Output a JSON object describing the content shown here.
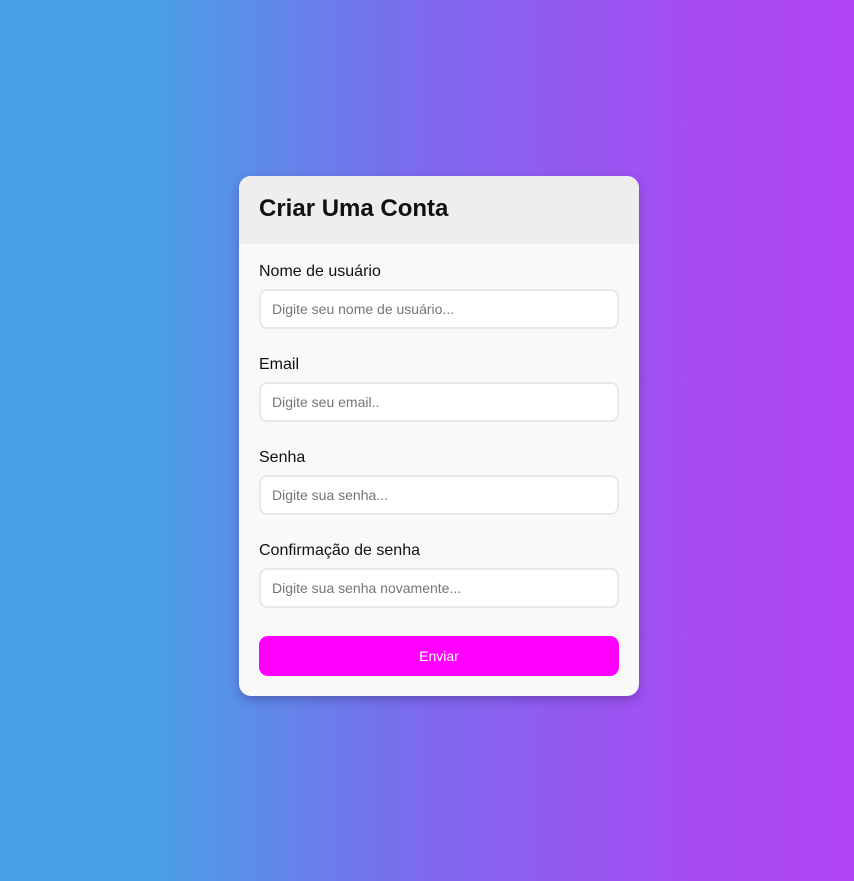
{
  "form": {
    "title": "Criar Uma Conta",
    "fields": [
      {
        "label": "Nome de usuário",
        "placeholder": "Digite seu nome de usuário...",
        "value": ""
      },
      {
        "label": "Email",
        "placeholder": "Digite seu email..",
        "value": ""
      },
      {
        "label": "Senha",
        "placeholder": "Digite sua senha...",
        "value": ""
      },
      {
        "label": "Confirmação de senha",
        "placeholder": "Digite sua senha novamente...",
        "value": ""
      }
    ],
    "submit_label": "Enviar"
  },
  "colors": {
    "background_gradient_start": "#46a1e5",
    "background_gradient_end": "#b044f3",
    "card_background": "#f9f9f9",
    "header_background": "#eeeeee",
    "button_background": "#ff00ff",
    "button_text": "#ffffff"
  }
}
